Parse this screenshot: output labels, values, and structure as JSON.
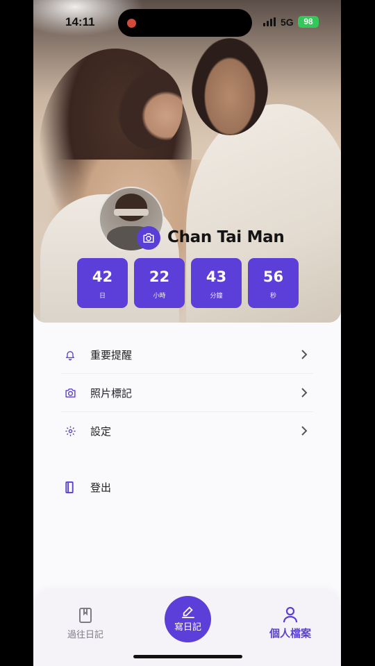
{
  "status_bar": {
    "time": "14:11",
    "network": "5G",
    "battery": "98"
  },
  "profile": {
    "name": "Chan Tai Man"
  },
  "countdown": [
    {
      "value": "42",
      "unit": "日"
    },
    {
      "value": "22",
      "unit": "小時"
    },
    {
      "value": "43",
      "unit": "分鐘"
    },
    {
      "value": "56",
      "unit": "秒"
    }
  ],
  "menu": {
    "items": [
      {
        "label": "重要提醒",
        "icon": "bell-icon"
      },
      {
        "label": "照片標記",
        "icon": "camera-icon"
      },
      {
        "label": "設定",
        "icon": "gear-icon"
      }
    ],
    "logout_label": "登出"
  },
  "tabbar": {
    "past_label": "過往日記",
    "write_label": "寫日記",
    "profile_label": "個人檔案"
  },
  "colors": {
    "accent": "#5b3fd8",
    "battery": "#34c759"
  }
}
